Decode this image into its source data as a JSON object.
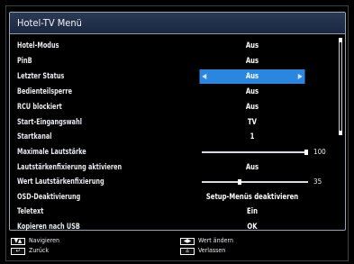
{
  "menu": {
    "title": "Hotel-TV Menü",
    "rows": [
      {
        "label": "Hotel-Modus",
        "value": "Aus"
      },
      {
        "label": "PinB",
        "value": "Aus"
      },
      {
        "label": "Letzter Status",
        "value": "Aus",
        "selected": true
      },
      {
        "label": "Bedienteilsperre",
        "value": "Aus"
      },
      {
        "label": "RCU blockiert",
        "value": "Aus"
      },
      {
        "label": "Start-Eingangswahl",
        "value": "TV"
      },
      {
        "label": "Startkanal",
        "value": "1"
      },
      {
        "label": "Maximale Lautstärke",
        "slider_value": "100",
        "slider_fraction": 1.0
      },
      {
        "label": "Lautstärkenfixierung aktivieren",
        "value": "Aus"
      },
      {
        "label": "Wert Lautstärkenfixierung",
        "slider_value": "35",
        "slider_fraction": 0.35
      },
      {
        "label": "OSD-Deaktivierung",
        "value": "Setup-Menüs deaktivieren"
      },
      {
        "label": "Teletext",
        "value": "Ein"
      },
      {
        "label": "Kopieren nach USB",
        "value": "OK"
      }
    ]
  },
  "footer": {
    "navigate_label": "Navigieren",
    "back_label": "Zurück",
    "change_label": "Wert ändern",
    "exit_label": "Verlassen"
  },
  "colors": {
    "highlight": "#2b86e0",
    "title_bar": "#1f2d48"
  }
}
